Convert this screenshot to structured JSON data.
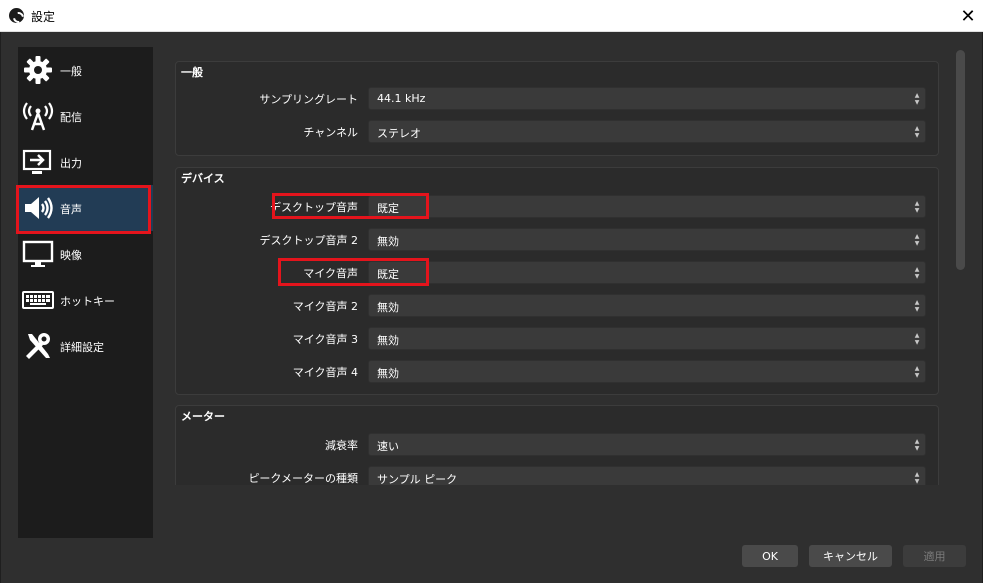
{
  "window": {
    "title": "設定",
    "close_glyph": "✕"
  },
  "sidebar": {
    "items": [
      {
        "label": "一般",
        "icon": "gear-icon"
      },
      {
        "label": "配信",
        "icon": "broadcast-icon"
      },
      {
        "label": "出力",
        "icon": "output-icon"
      },
      {
        "label": "音声",
        "icon": "speaker-icon"
      },
      {
        "label": "映像",
        "icon": "monitor-icon"
      },
      {
        "label": "ホットキー",
        "icon": "keyboard-icon"
      },
      {
        "label": "詳細設定",
        "icon": "tools-icon"
      }
    ],
    "active": "音声"
  },
  "general": {
    "title": "一般",
    "sample_rate": {
      "label": "サンプリングレート",
      "value": "44.1 kHz"
    },
    "channels": {
      "label": "チャンネル",
      "value": "ステレオ"
    }
  },
  "devices": {
    "title": "デバイス",
    "desktop_audio": {
      "label": "デスクトップ音声",
      "value": "既定"
    },
    "desktop_audio_2": {
      "label": "デスクトップ音声 2",
      "value": "無効"
    },
    "mic_audio": {
      "label": "マイク音声",
      "value": "既定"
    },
    "mic_audio_2": {
      "label": "マイク音声 2",
      "value": "無効"
    },
    "mic_audio_3": {
      "label": "マイク音声 3",
      "value": "無効"
    },
    "mic_audio_4": {
      "label": "マイク音声 4",
      "value": "無効"
    }
  },
  "meters": {
    "title": "メーター",
    "decay_rate": {
      "label": "減衰率",
      "value": "速い"
    },
    "peak_meter_type": {
      "label": "ピークメーターの種類",
      "value": "サンプル ピーク"
    }
  },
  "buttons": {
    "ok": "OK",
    "cancel": "キャンセル",
    "apply": "適用"
  },
  "colors": {
    "highlight": "#e4141c",
    "sidebar_active": "#223c55",
    "background": "#2f2f2f"
  }
}
